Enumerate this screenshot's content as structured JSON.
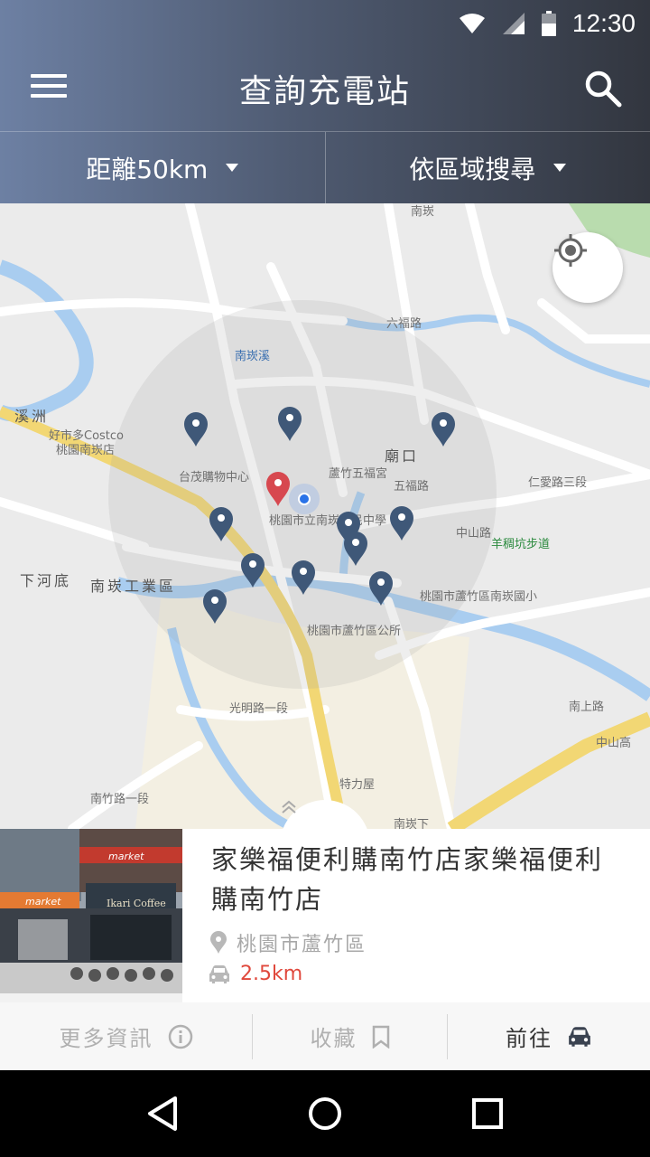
{
  "status_bar": {
    "time": "12:30",
    "wifi_icon": "wifi-icon",
    "signal_icon": "signal-icon",
    "battery_icon": "battery-icon"
  },
  "header": {
    "title": "查詢充電站",
    "menu_icon": "menu-icon",
    "search_icon": "search-icon"
  },
  "filters": {
    "distance": "距離50km",
    "region": "依區域搜尋"
  },
  "map": {
    "labels": {
      "l1": "南崁",
      "l2": "溪洲",
      "l3": "好市多Costco",
      "l4": "桃園南崁店",
      "l5": "台茂購物中心",
      "l6": "廟口",
      "l7": "蘆竹五福宮",
      "l8": "桃園市立南崁國民中學",
      "l9": "南崁工業區",
      "l10": "下河底",
      "l11": "桃園市蘆竹區公所",
      "l12": "桃園市蘆竹區南崁國小",
      "l13": "羊稠坑步道",
      "l14": "特力屋",
      "l15": "南崁溪",
      "l16": "南崁下",
      "l17": "南上路",
      "l18": "中山高",
      "l19": "六福路",
      "l20": "仁愛路三段",
      "l21": "五福路",
      "l22": "中山路",
      "l23": "光明路一段",
      "l24": "南竹路一段"
    }
  },
  "station": {
    "name": "家樂福便利購南竹店家樂福便利購南竹店",
    "address": "桃園市蘆竹區",
    "distance": "2.5km",
    "photo_sign1": "market",
    "photo_sign2": "market",
    "photo_sign3": "Ikari Coffee"
  },
  "actions": {
    "more_info": "更多資訊",
    "favorite": "收藏",
    "go": "前往"
  },
  "colors": {
    "accent_red": "#e0483c",
    "pin_blue": "#3f5878",
    "pin_red": "#d7484f",
    "header_start": "#6d80a3",
    "header_end": "#32363f"
  }
}
